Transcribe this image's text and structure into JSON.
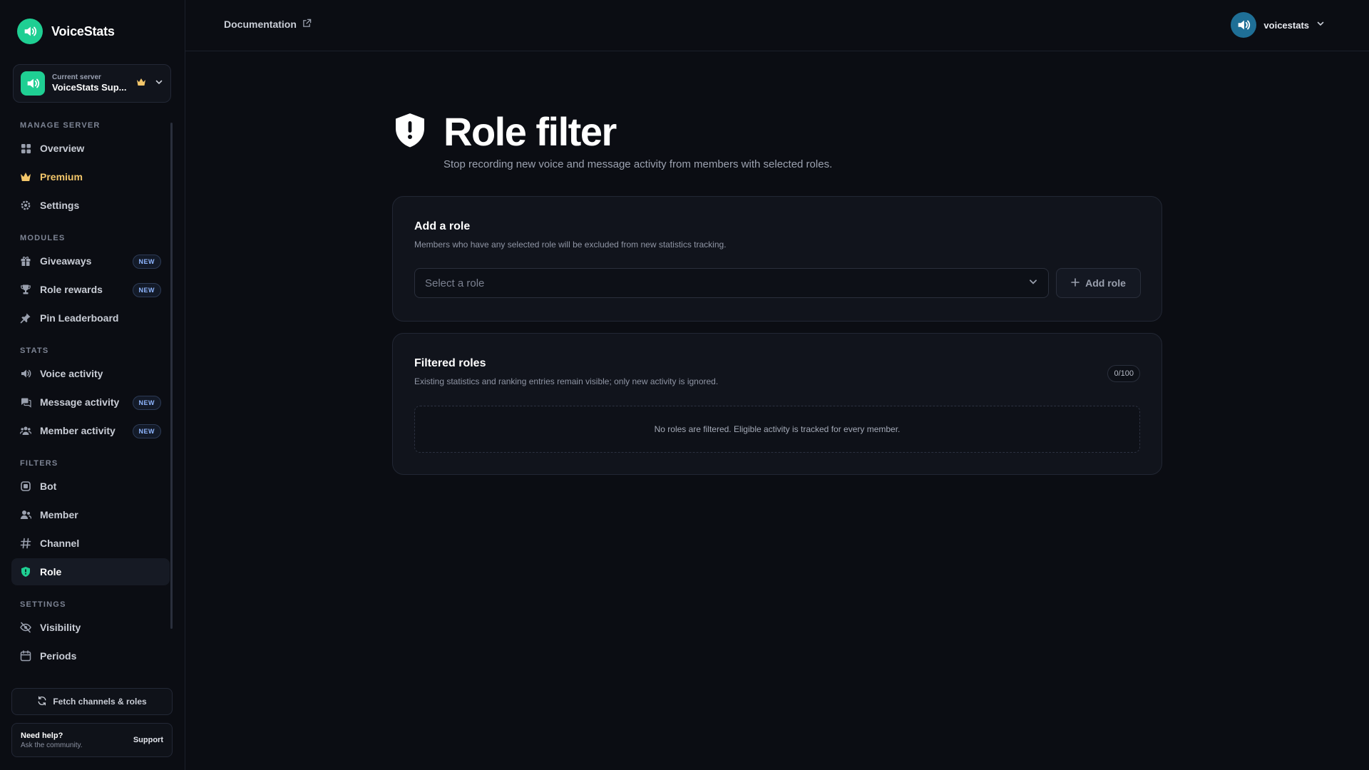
{
  "app": {
    "name": "VoiceStats"
  },
  "server": {
    "caption": "Current server",
    "name": "VoiceStats Sup..."
  },
  "sidebar": {
    "sections": [
      {
        "title": "Manage server",
        "items": [
          {
            "label": "Overview",
            "icon": "grid-icon"
          },
          {
            "label": "Premium",
            "icon": "crown-icon"
          },
          {
            "label": "Settings",
            "icon": "gear-icon"
          }
        ]
      },
      {
        "title": "Modules",
        "items": [
          {
            "label": "Giveaways",
            "icon": "gift-icon",
            "badge": "NEW"
          },
          {
            "label": "Role rewards",
            "icon": "trophy-icon",
            "badge": "NEW"
          },
          {
            "label": "Pin Leaderboard",
            "icon": "pin-icon"
          }
        ]
      },
      {
        "title": "Stats",
        "items": [
          {
            "label": "Voice activity",
            "icon": "speaker-icon"
          },
          {
            "label": "Message activity",
            "icon": "chat-icon",
            "badge": "NEW"
          },
          {
            "label": "Member activity",
            "icon": "users-icon",
            "badge": "NEW"
          }
        ]
      },
      {
        "title": "Filters",
        "items": [
          {
            "label": "Bot",
            "icon": "bot-icon"
          },
          {
            "label": "Member",
            "icon": "member-icon"
          },
          {
            "label": "Channel",
            "icon": "hash-icon"
          },
          {
            "label": "Role",
            "icon": "shield-icon",
            "active": true
          }
        ]
      },
      {
        "title": "Settings",
        "items": [
          {
            "label": "Visibility",
            "icon": "eye-off-icon"
          },
          {
            "label": "Periods",
            "icon": "calendar-icon"
          }
        ]
      }
    ],
    "fetch_label": "Fetch channels & roles",
    "help_title": "Need help?",
    "help_subtitle": "Ask the community.",
    "support_label": "Support"
  },
  "topbar": {
    "doc_label": "Documentation",
    "user_name": "voicestats"
  },
  "page": {
    "title": "Role filter",
    "subtitle": "Stop recording new voice and message activity from members with selected roles."
  },
  "add_role_card": {
    "title": "Add a role",
    "description": "Members who have any selected role will be excluded from new statistics tracking.",
    "select_placeholder": "Select a role",
    "button_label": "Add role"
  },
  "filtered_card": {
    "title": "Filtered roles",
    "description": "Existing statistics and ranking entries remain visible; only new activity is ignored.",
    "count": "0/100",
    "empty_text": "No roles are filtered. Eligible activity is tracked for every member."
  },
  "colors": {
    "accent": "#1fcf93",
    "premium": "#f3c66a",
    "background": "#0b0d13",
    "card": "#11141c"
  }
}
